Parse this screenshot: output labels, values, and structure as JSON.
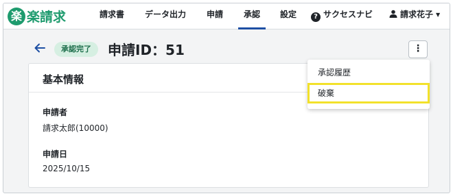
{
  "app": {
    "logo_mark": "楽",
    "logo_text": "楽請求"
  },
  "nav": {
    "items": [
      {
        "label": "請求書"
      },
      {
        "label": "データ出力"
      },
      {
        "label": "申請"
      },
      {
        "label": "承認"
      },
      {
        "label": "設定"
      }
    ],
    "help_label": "サクセスナビ",
    "user_label": "請求花子"
  },
  "title_row": {
    "status_badge": "承認完了",
    "page_title": "申請ID：51",
    "kebab": "⋮"
  },
  "card": {
    "header": "基本情報",
    "fields": [
      {
        "label": "申請者",
        "value": "請求太郎(10000)"
      },
      {
        "label": "申請日",
        "value": "2025/10/15"
      }
    ]
  },
  "menu": {
    "items": [
      {
        "label": "承認履歴"
      },
      {
        "label": "破棄"
      }
    ]
  },
  "colors": {
    "brand": "#1e9b6e",
    "active_tab": "#1d4fa3",
    "highlight": "#f2e12a"
  }
}
